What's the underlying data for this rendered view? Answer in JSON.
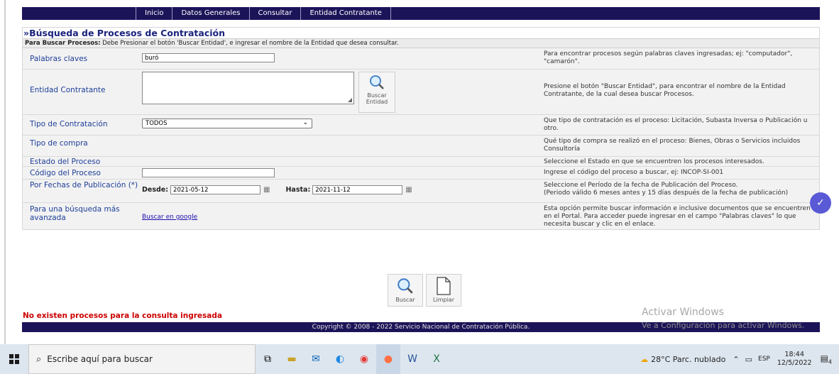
{
  "nav": [
    "Inicio",
    "Datos Generales",
    "Consultar",
    "Entidad Contratante"
  ],
  "title": "»Búsqueda de Procesos de Contratación",
  "instruction_bold": "Para Buscar Procesos:",
  "instruction_text": " Debe Presionar el botón 'Buscar Entidad', e ingresar el nombre de la Entidad que desea consultar.",
  "rows": {
    "palabras": {
      "label": "Palabras claves",
      "value": "buró",
      "help": "Para encontrar procesos según palabras claves ingresadas; ej: \"computador\", \"camarón\"."
    },
    "entidad": {
      "label": "Entidad Contratante",
      "button": [
        "Buscar",
        "Entidad"
      ],
      "help": "Presione el botón \"Buscar Entidad\", para encontrar el nombre de la Entidad Contratante, de la cual desea buscar Procesos."
    },
    "tipo_contratacion": {
      "label": "Tipo de Contratación",
      "selected": "TODOS",
      "help": "Que tipo de contratación es el proceso: Licitación, Subasta Inversa o Publicación u otro."
    },
    "tipo_compra": {
      "label": "Tipo de compra",
      "help": "Qué tipo de compra se realizó en el proceso: Bienes, Obras o Servicios incluidos Consultoría"
    },
    "estado": {
      "label": "Estado del Proceso",
      "help": "Seleccione el Estado en que se encuentren los procesos interesados."
    },
    "codigo": {
      "label": "Código del Proceso",
      "value": "",
      "help": "Ingrese el código del proceso a buscar, ej: INCOP-SI-001"
    },
    "fechas": {
      "label": "Por Fechas de Publicación (*)",
      "desde_label": "Desde:",
      "desde": "2021-05-12",
      "hasta_label": "Hasta:",
      "hasta": "2021-11-12",
      "help1": "Seleccione el Período de la fecha de Publicación del Proceso.",
      "help2": "(Periodo válido 6 meses antes y 15 días después de la fecha de publicación)"
    },
    "avanzada": {
      "label": "Para una búsqueda más avanzada",
      "link": "Buscar en google",
      "help": "Esta opción permite buscar información e inclusive documentos que se encuentren en el Portal. Para acceder puede ingresar en el campo \"Palabras claves\" lo que necesita buscar y clic en el enlace."
    }
  },
  "actions": {
    "buscar": "Buscar",
    "limpiar": "Limpiar"
  },
  "no_results": "No existen procesos para la consulta ingresada",
  "footer": "Copyright © 2008 - 2022 Servicio Nacional de Contratación Pública.",
  "watermark": {
    "line1": "Activar Windows",
    "line2": "Ve a Configuración para activar Windows."
  },
  "taskbar": {
    "search_placeholder": "Escribe aquí para buscar",
    "weather": "28°C  Parc. nublado",
    "lang": "ESP",
    "time": "18:44",
    "date": "12/5/2022",
    "notif_count": "4"
  }
}
